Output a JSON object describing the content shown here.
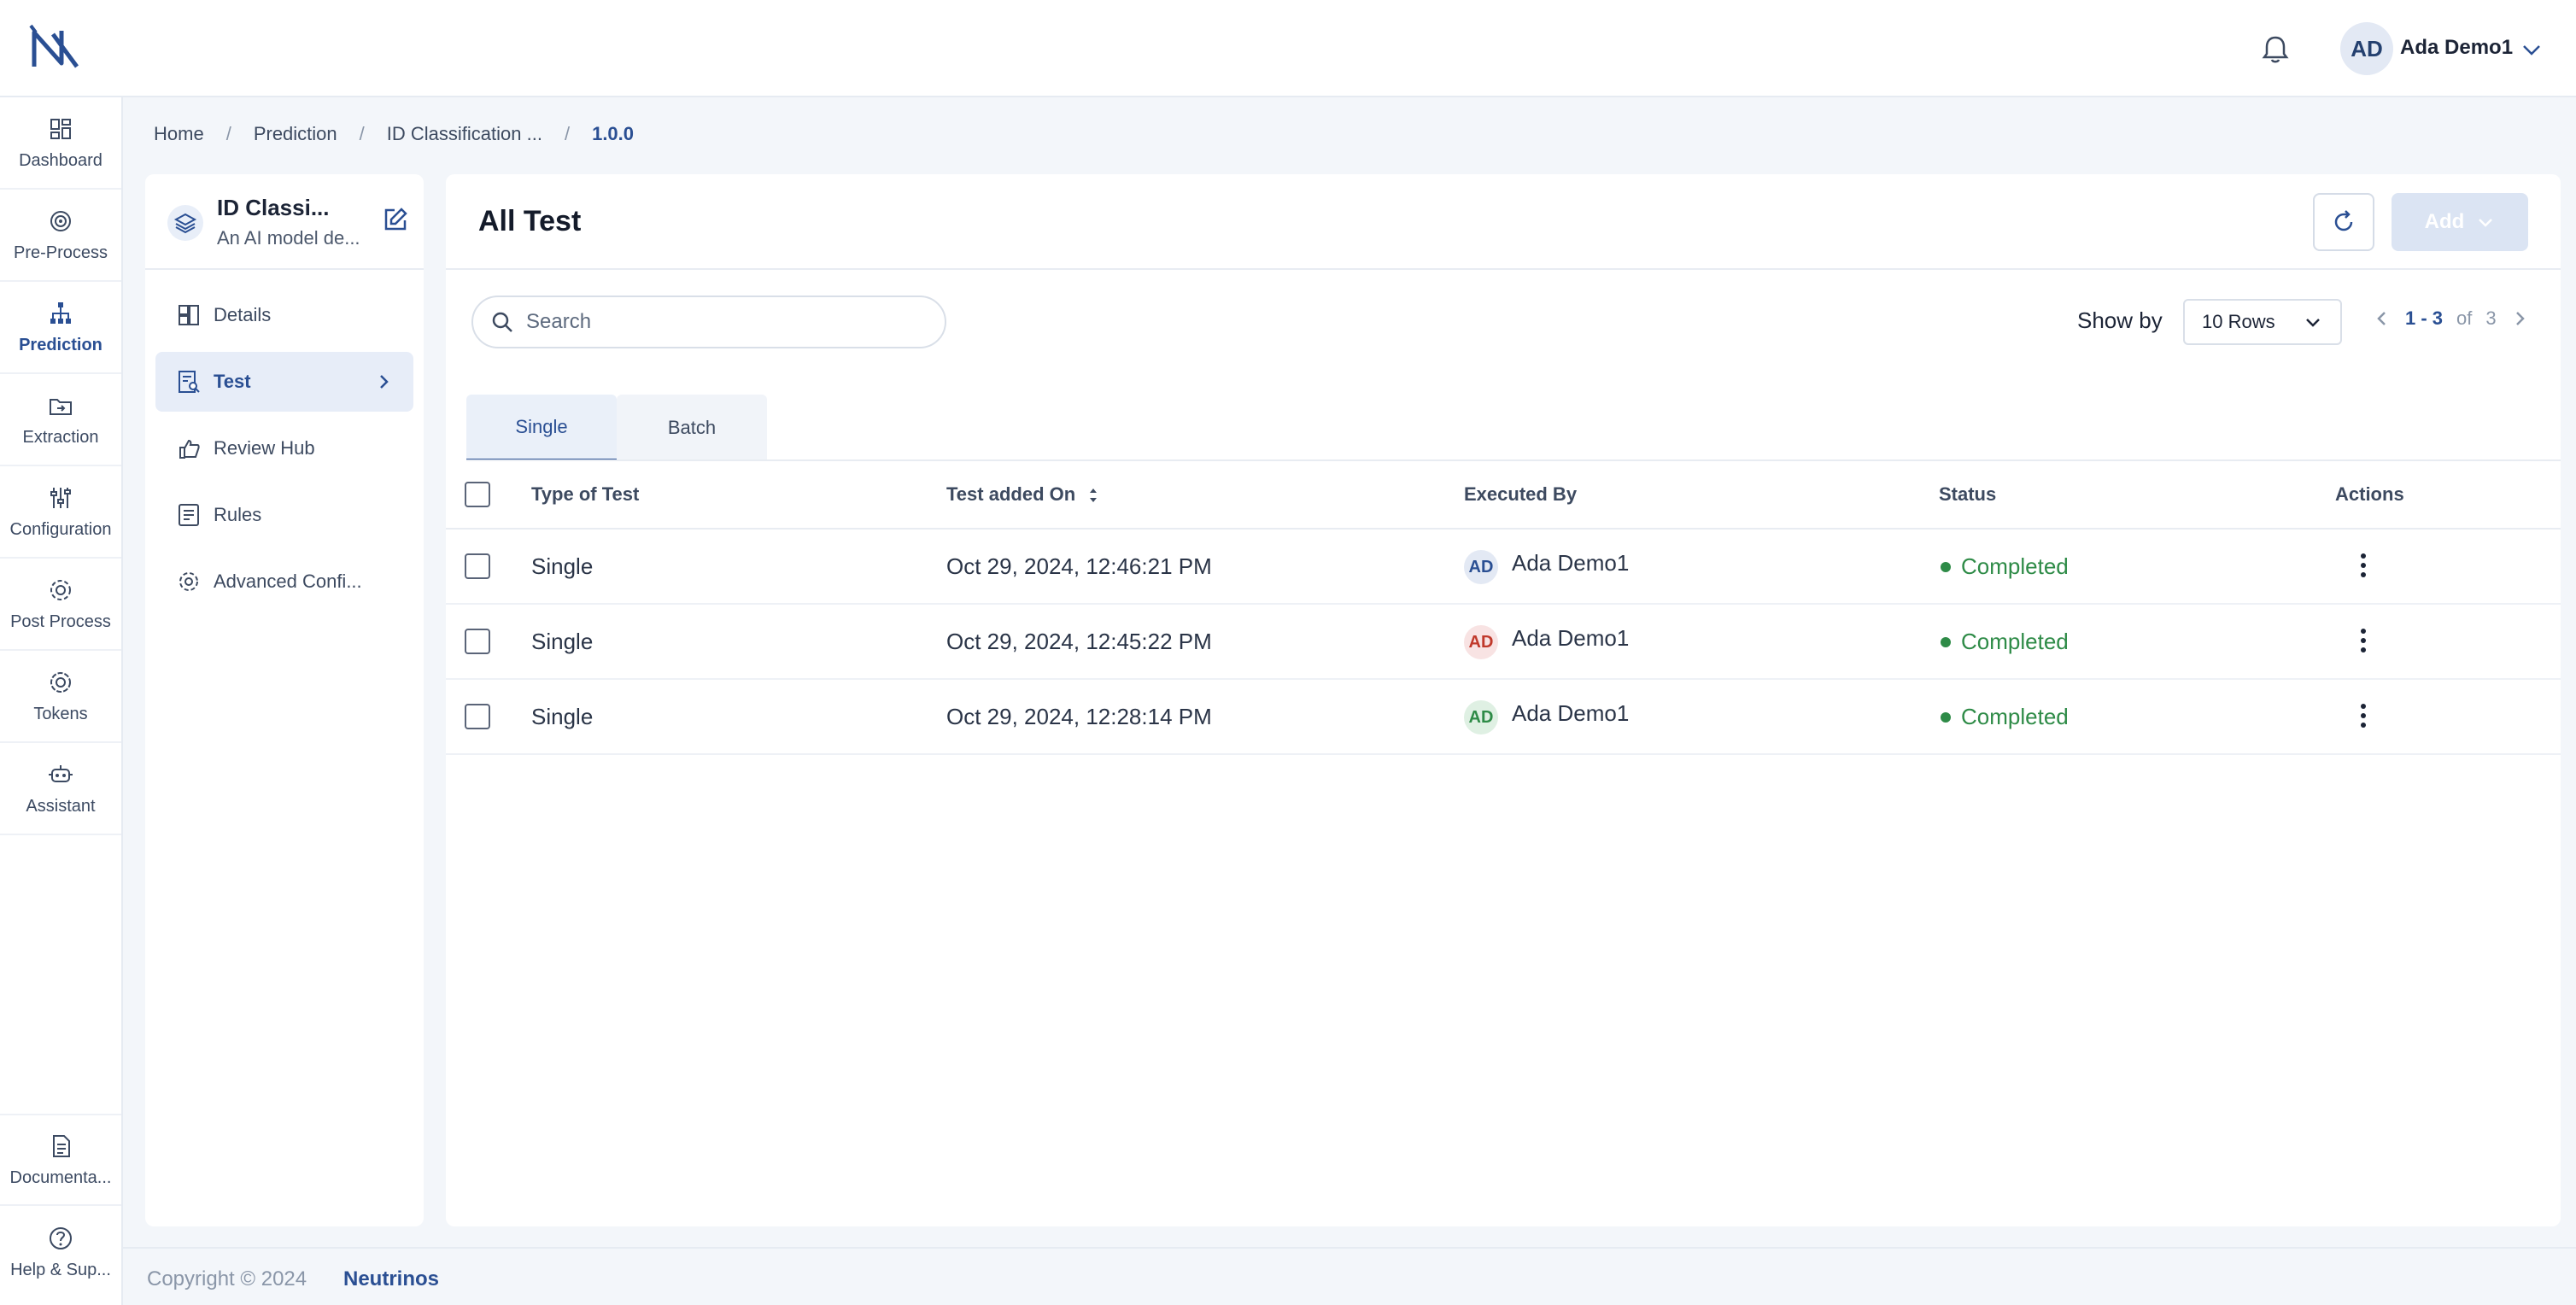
{
  "header": {
    "user_initials": "AD",
    "user_name": "Ada Demo1"
  },
  "nav": {
    "items": [
      {
        "label": "Dashboard"
      },
      {
        "label": "Pre-Process"
      },
      {
        "label": "Prediction"
      },
      {
        "label": "Extraction"
      },
      {
        "label": "Configuration"
      },
      {
        "label": "Post Process"
      },
      {
        "label": "Tokens"
      },
      {
        "label": "Assistant"
      }
    ],
    "bottom": [
      {
        "label": "Documenta..."
      },
      {
        "label": "Help & Sup..."
      }
    ],
    "active": "Prediction"
  },
  "breadcrumb": [
    "Home",
    "Prediction",
    "ID Classification ...",
    "1.0.0"
  ],
  "model": {
    "title": "ID Classi...",
    "subtitle": "An AI model de..."
  },
  "side_menu": [
    {
      "label": "Details"
    },
    {
      "label": "Test"
    },
    {
      "label": "Review Hub"
    },
    {
      "label": "Rules"
    },
    {
      "label": "Advanced Confi..."
    }
  ],
  "main": {
    "title": "All Test",
    "add_label": "Add",
    "search_placeholder": "Search",
    "show_by_label": "Show by",
    "rows_option": "10 Rows",
    "page_range": "1 - 3",
    "page_of": "of",
    "page_total": "3",
    "tabs": [
      "Single",
      "Batch"
    ],
    "active_tab": "Single",
    "columns": [
      "Type of Test",
      "Test added On",
      "Executed By",
      "Status",
      "Actions"
    ],
    "rows": [
      {
        "type": "Single",
        "added_on": "Oct 29, 2024, 12:46:21 PM",
        "initials": "AD",
        "executed_by": "Ada Demo1",
        "avatar_bg": "#e3e9f4",
        "avatar_fg": "#2a4f93",
        "status": "Completed"
      },
      {
        "type": "Single",
        "added_on": "Oct 29, 2024, 12:45:22 PM",
        "initials": "AD",
        "executed_by": "Ada Demo1",
        "avatar_bg": "#f8e3e3",
        "avatar_fg": "#c0392b",
        "status": "Completed"
      },
      {
        "type": "Single",
        "added_on": "Oct 29, 2024, 12:28:14 PM",
        "initials": "AD",
        "executed_by": "Ada Demo1",
        "avatar_bg": "#dff0e3",
        "avatar_fg": "#2e8b47",
        "status": "Completed"
      }
    ],
    "status_color": "#2e8b47"
  },
  "footer": {
    "copyright": "Copyright © 2024",
    "brand": "Neutrinos"
  }
}
